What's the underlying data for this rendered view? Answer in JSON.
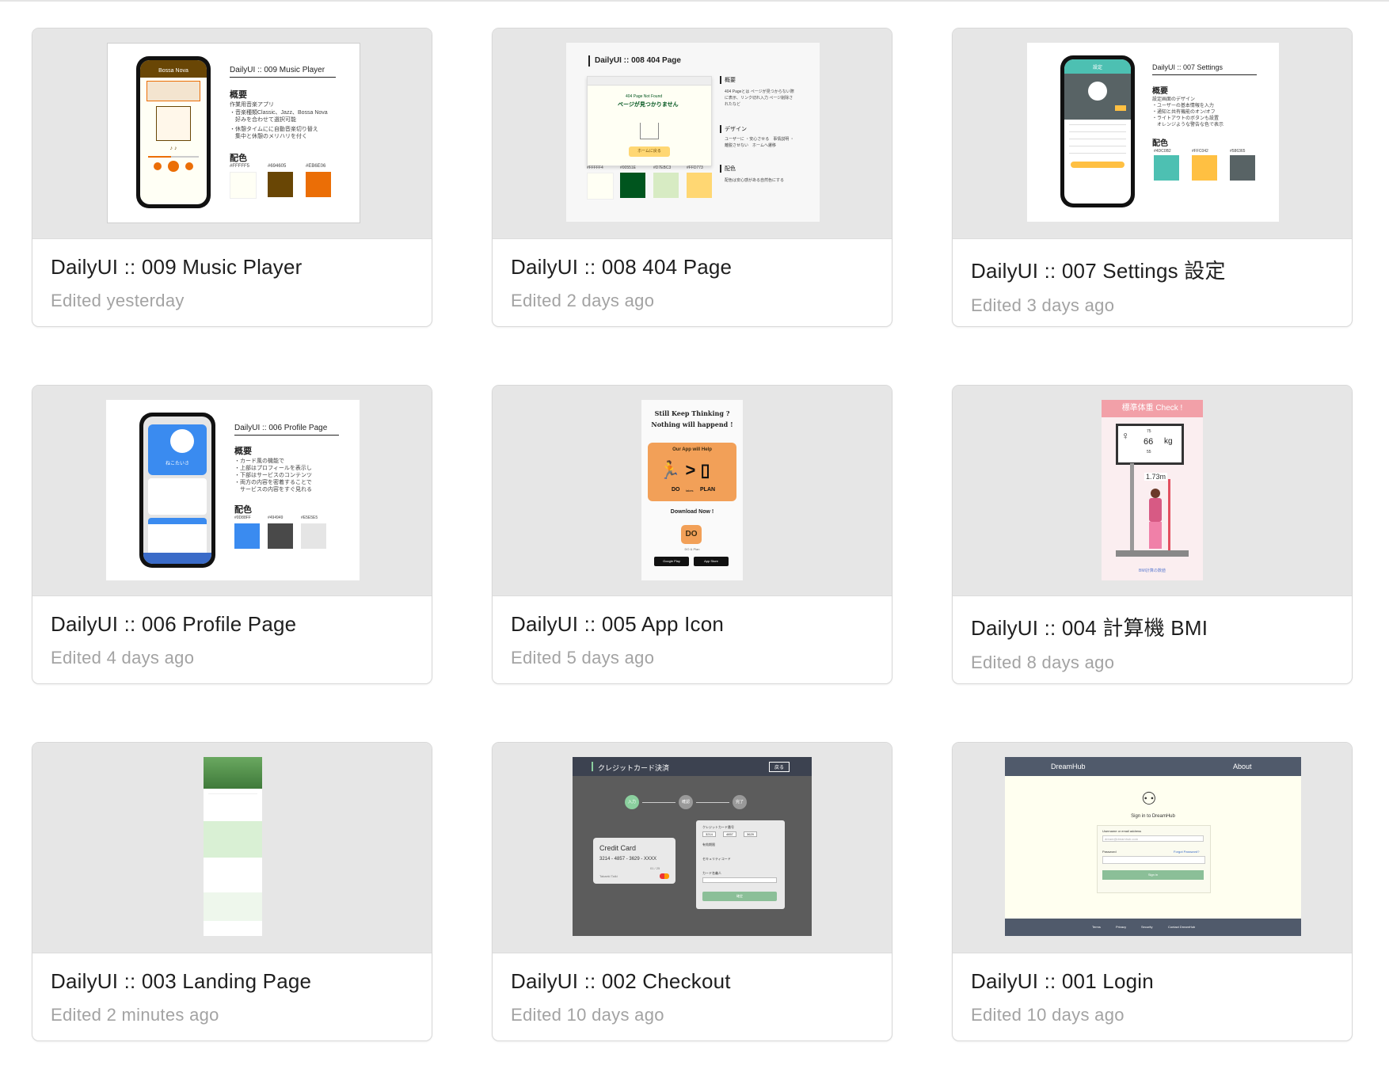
{
  "cards": [
    {
      "title": "DailyUI :: 009 Music Player",
      "edited": "Edited yesterday",
      "thumb": {
        "heading": "DailyUI :: 009 Music Player",
        "overview_label": "概要",
        "overview_lines": [
          "作業用音楽アプリ",
          "・音楽種類Classic、Jazz、Bossa Nova",
          "　好みを合わせて選択可能",
          "・休憩タイムにに自動音楽切り替え",
          "　集中と休憩のメリハリを付く"
        ],
        "color_label": "配色",
        "app_title": "Bossa Nova",
        "swatches": [
          {
            "hex": "#FFFFF5",
            "color": "#fffff5"
          },
          {
            "hex": "#694605",
            "color": "#694605"
          },
          {
            "hex": "#EB6E06",
            "color": "#eb6e06"
          }
        ]
      }
    },
    {
      "title": "DailyUI :: 008 404 Page",
      "edited": "Edited 2 days ago",
      "thumb": {
        "heading": "DailyUI :: 008 404 Page",
        "notfound_en": "404 Page Not Found",
        "notfound_jp": "ページが見つかりません",
        "home_button": "ホームに戻る",
        "overview_label": "概要",
        "overview_text": "404 Pageとは ページが見つからない際に表示、リンク切れ入力 ページ削除されたなど",
        "design_label": "デザイン",
        "design_text": "ユーザーに ・安心させる　事情説明 ・離脱させない　ホームへ遷移",
        "color_label": "配色",
        "color_text": "配色は安心感がある自然色にする",
        "swatches": [
          {
            "hex": "#FFFFF4",
            "color": "#fffff4"
          },
          {
            "hex": "#00551E",
            "color": "#00551e"
          },
          {
            "hex": "#D7EBC3",
            "color": "#d7ebc3"
          },
          {
            "hex": "#FFD773",
            "color": "#ffd773"
          }
        ]
      }
    },
    {
      "title": "DailyUI :: 007 Settings 設定",
      "edited": "Edited 3 days ago",
      "thumb": {
        "heading": "DailyUI :: 007 Settings",
        "overview_label": "概要",
        "overview_lines": [
          "設定画面のデザイン",
          "・ユーザーの基本情報を入力",
          "・通知と共有機能のオン/オフ",
          "・ライトアウトのボタンも設置",
          "　オレンジような警告な色で表示"
        ],
        "color_label": "配色",
        "app_title": "設定",
        "swatches": [
          {
            "hex": "#4DC0B2",
            "color": "#4dc0b2"
          },
          {
            "hex": "#FFC042",
            "color": "#ffc042"
          },
          {
            "hex": "#586365",
            "color": "#586365"
          }
        ]
      }
    },
    {
      "title": "DailyUI :: 006 Profile Page",
      "edited": "Edited 4 days ago",
      "thumb": {
        "heading": "DailyUI :: 006 Profile Page",
        "overview_label": "概要",
        "overview_lines": [
          "・カード風の機能で",
          "・上部はプロフィールを表示し",
          "・下部はサービスのコンテンツ",
          "・両方の内容を密着することで",
          "　サービスの内容をすぐ見れる"
        ],
        "color_label": "配色",
        "app_name": "ねこたいさ",
        "swatches": [
          {
            "hex": "#0D88FF",
            "color": "#3a8bf0"
          },
          {
            "hex": "#494949",
            "color": "#494949"
          },
          {
            "hex": "#E5E5E5",
            "color": "#e5e5e5"
          }
        ]
      }
    },
    {
      "title": "DailyUI :: 005 App Icon",
      "edited": "Edited 5 days ago",
      "thumb": {
        "line1": "Still Keep Thinking ?",
        "line2": "Nothing will happend !",
        "card_top": "Our App will Help",
        "do_label": "DO",
        "takes_label": "takes",
        "plan_label": "PLAN",
        "download": "Download Now !",
        "icon_text": "DO",
        "icon_caption": "DO & Plan",
        "store1": "Google Play",
        "store2": "App Store"
      }
    },
    {
      "title": "DailyUI :: 004 計算機 BMI",
      "edited": "Edited 8 days ago",
      "thumb": {
        "header": "標準体重 Check !",
        "weight": "66",
        "weight_up": "75",
        "weight_down": "55",
        "unit": "kg",
        "height": "1.73m",
        "footer": "BMI計算の数値"
      }
    },
    {
      "title": "DailyUI :: 003 Landing Page",
      "edited": "Edited 2 minutes ago",
      "thumb": {}
    },
    {
      "title": "DailyUI :: 002 Checkout",
      "edited": "Edited 10 days ago",
      "thumb": {
        "header": "クレジットカード決済",
        "back": "戻る",
        "steps": [
          "入力",
          "確認",
          "完了"
        ],
        "card_label": "Credit Card",
        "card_number": "3214 - 4857 - 3629 - XXXX",
        "card_expiry": "01 / 25",
        "card_holder": "Takaeki Taiki",
        "form_number_label": "クレジットカード番号",
        "form_fields": [
          "3214",
          "4857",
          "3629"
        ],
        "form_expiry_label": "有効期限",
        "form_cvc_label": "セキュリティコード",
        "form_name_label": "カード名義人",
        "submit": "確定"
      }
    },
    {
      "title": "DailyUI :: 001 Login",
      "edited": "Edited 10 days ago",
      "thumb": {
        "brand": "DreamHub",
        "about": "About",
        "signin_title": "Sign in to DreamHub",
        "user_label": "Username or email address",
        "user_placeholder": "dream@dreamhub.com",
        "password_label": "Password",
        "forgot": "Forgot Password?",
        "signin_button": "Sign in",
        "footer_links": [
          "Terms",
          "Privacy",
          "Security",
          "Contact DreamHub"
        ]
      }
    }
  ]
}
